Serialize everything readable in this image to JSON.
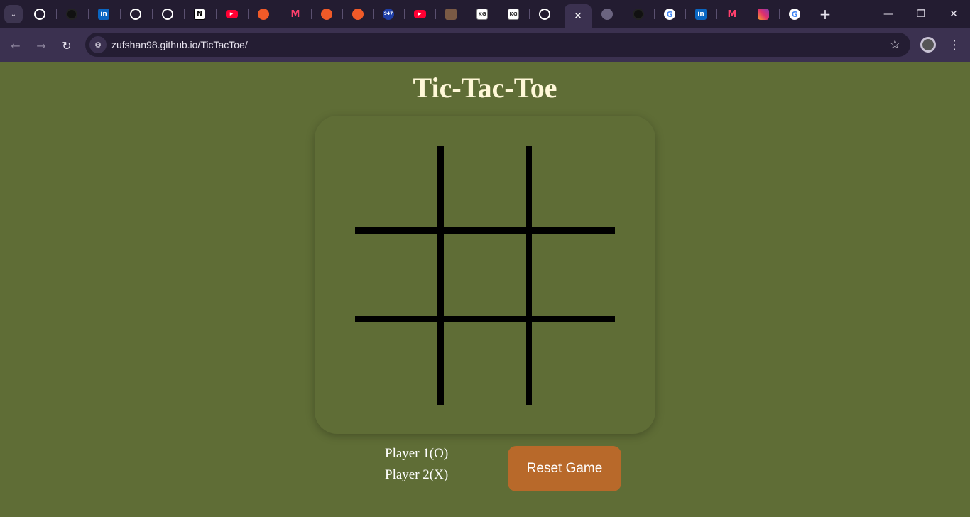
{
  "browser": {
    "url": "zufshan98.github.io/TicTacToe/",
    "tabs": [
      {
        "icon": "github-icon"
      },
      {
        "icon": "github-icon"
      },
      {
        "icon": "linkedin-icon"
      },
      {
        "icon": "github-icon"
      },
      {
        "icon": "github-icon"
      },
      {
        "icon": "notion-icon"
      },
      {
        "icon": "youtube-icon"
      },
      {
        "icon": "swiggy-icon"
      },
      {
        "icon": "myntra-icon"
      },
      {
        "icon": "swiggy-icon"
      },
      {
        "icon": "swiggy-icon"
      },
      {
        "icon": "radio-947-icon"
      },
      {
        "icon": "youtube-icon"
      },
      {
        "icon": "photo-icon"
      },
      {
        "icon": "kg-icon"
      },
      {
        "icon": "kg-icon"
      },
      {
        "icon": "github-icon"
      },
      {
        "icon": "close-icon",
        "active": true
      },
      {
        "icon": "globe-icon"
      },
      {
        "icon": "github-icon"
      },
      {
        "icon": "google-icon"
      },
      {
        "icon": "linkedin-icon"
      },
      {
        "icon": "myntra-icon"
      },
      {
        "icon": "instagram-icon"
      },
      {
        "icon": "google-icon"
      }
    ]
  },
  "game": {
    "title": "Tic-Tac-Toe",
    "player1": "Player 1(O)",
    "player2": "Player 2(X)",
    "reset_label": "Reset Game"
  },
  "colors": {
    "page_bg": "#5f6d36",
    "title": "#fff8d8",
    "button_bg": "#b8692a",
    "grid_lines": "#000000"
  }
}
